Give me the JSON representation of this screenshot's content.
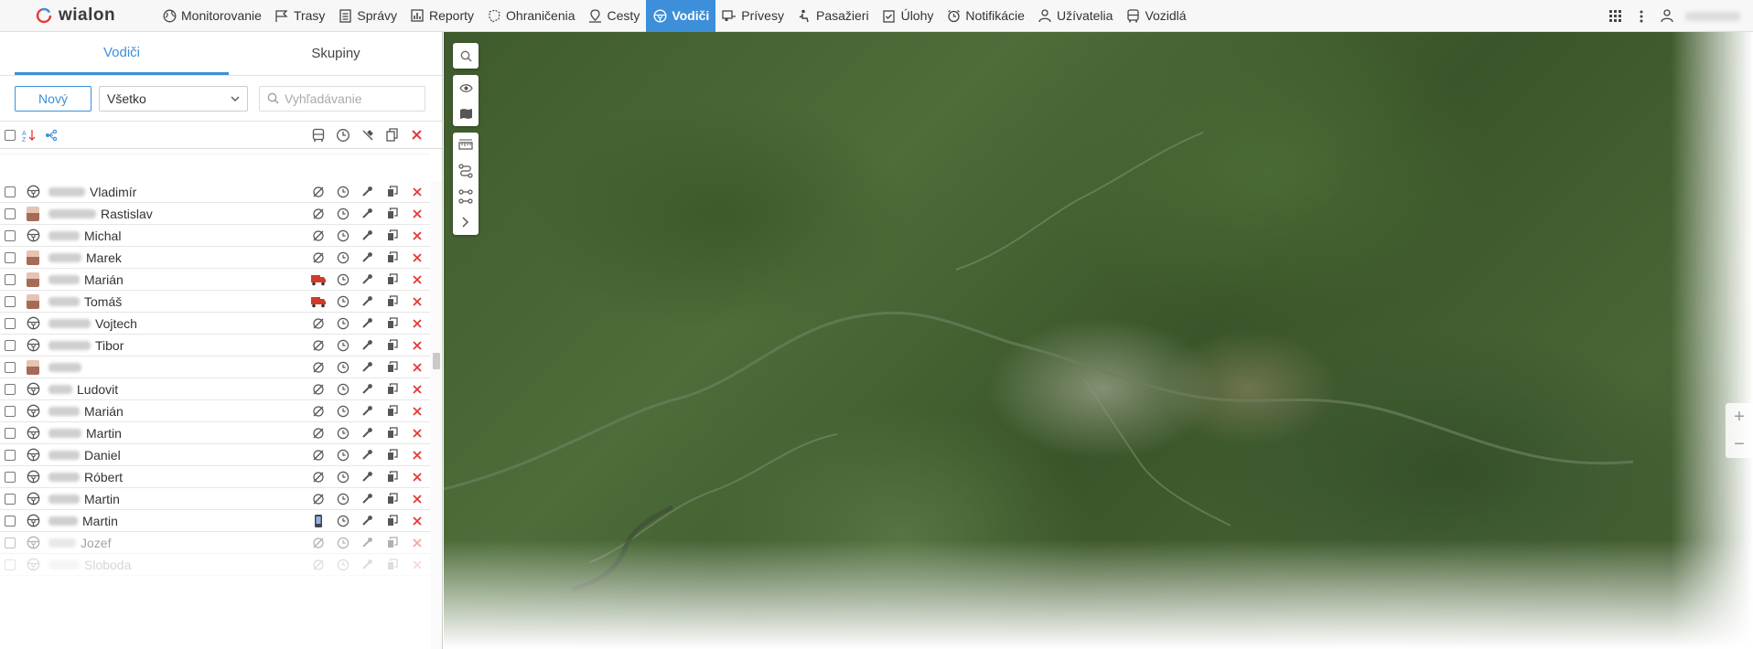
{
  "brand": {
    "name": "wialon"
  },
  "nav": {
    "items": [
      {
        "label": "Monitorovanie",
        "icon": "globe-icon"
      },
      {
        "label": "Trasy",
        "icon": "route-flag-icon"
      },
      {
        "label": "Správy",
        "icon": "document-icon"
      },
      {
        "label": "Reporty",
        "icon": "bar-chart-icon"
      },
      {
        "label": "Ohraničenia",
        "icon": "geofence-icon"
      },
      {
        "label": "Cesty",
        "icon": "road-pin-icon"
      },
      {
        "label": "Vodiči",
        "icon": "steering-wheel-icon",
        "active": true
      },
      {
        "label": "Prívesy",
        "icon": "trailer-icon"
      },
      {
        "label": "Pasažieri",
        "icon": "passenger-icon"
      },
      {
        "label": "Úlohy",
        "icon": "clipboard-check-icon"
      },
      {
        "label": "Notifikácie",
        "icon": "alarm-clock-icon"
      },
      {
        "label": "Užívatelia",
        "icon": "user-icon"
      },
      {
        "label": "Vozidlá",
        "icon": "bus-icon"
      }
    ],
    "accent": "#3d8fd9"
  },
  "panel": {
    "tabs": [
      {
        "label": "Vodiči",
        "active": true
      },
      {
        "label": "Skupiny"
      }
    ],
    "new_label": "Nový",
    "filter_value": "Všetko",
    "search_placeholder": "Vyhľadávanie"
  },
  "drivers": [
    {
      "name": "Vladimír",
      "avatar": "wheel",
      "unit": "none"
    },
    {
      "name": "Rastislav",
      "avatar": "photo",
      "unit": "none"
    },
    {
      "name": "Michal",
      "avatar": "wheel",
      "unit": "none"
    },
    {
      "name": "Marek",
      "avatar": "photo",
      "unit": "none"
    },
    {
      "name": "Marián",
      "avatar": "photo",
      "unit": "truck"
    },
    {
      "name": "Tomáš",
      "avatar": "photo",
      "unit": "truck"
    },
    {
      "name": "Vojtech",
      "avatar": "wheel",
      "unit": "none"
    },
    {
      "name": "Tibor",
      "avatar": "wheel",
      "unit": "none"
    },
    {
      "name": "",
      "avatar": "photo",
      "unit": "none"
    },
    {
      "name": "Ludovit",
      "avatar": "wheel",
      "unit": "none"
    },
    {
      "name": "Marián",
      "avatar": "wheel",
      "unit": "none"
    },
    {
      "name": "Martin",
      "avatar": "wheel",
      "unit": "none"
    },
    {
      "name": "Daniel",
      "avatar": "wheel",
      "unit": "none"
    },
    {
      "name": "Róbert",
      "avatar": "wheel",
      "unit": "none"
    },
    {
      "name": "Martin",
      "avatar": "wheel",
      "unit": "none"
    },
    {
      "name": "Martin",
      "avatar": "wheel",
      "unit": "phone"
    },
    {
      "name": "Jozef",
      "avatar": "wheel",
      "unit": "none",
      "faded": true
    },
    {
      "name": "Sloboda",
      "avatar": "wheel",
      "unit": "none",
      "faded": true
    }
  ],
  "colors": {
    "delete": "#e53935",
    "truck": "#d13b2a"
  }
}
